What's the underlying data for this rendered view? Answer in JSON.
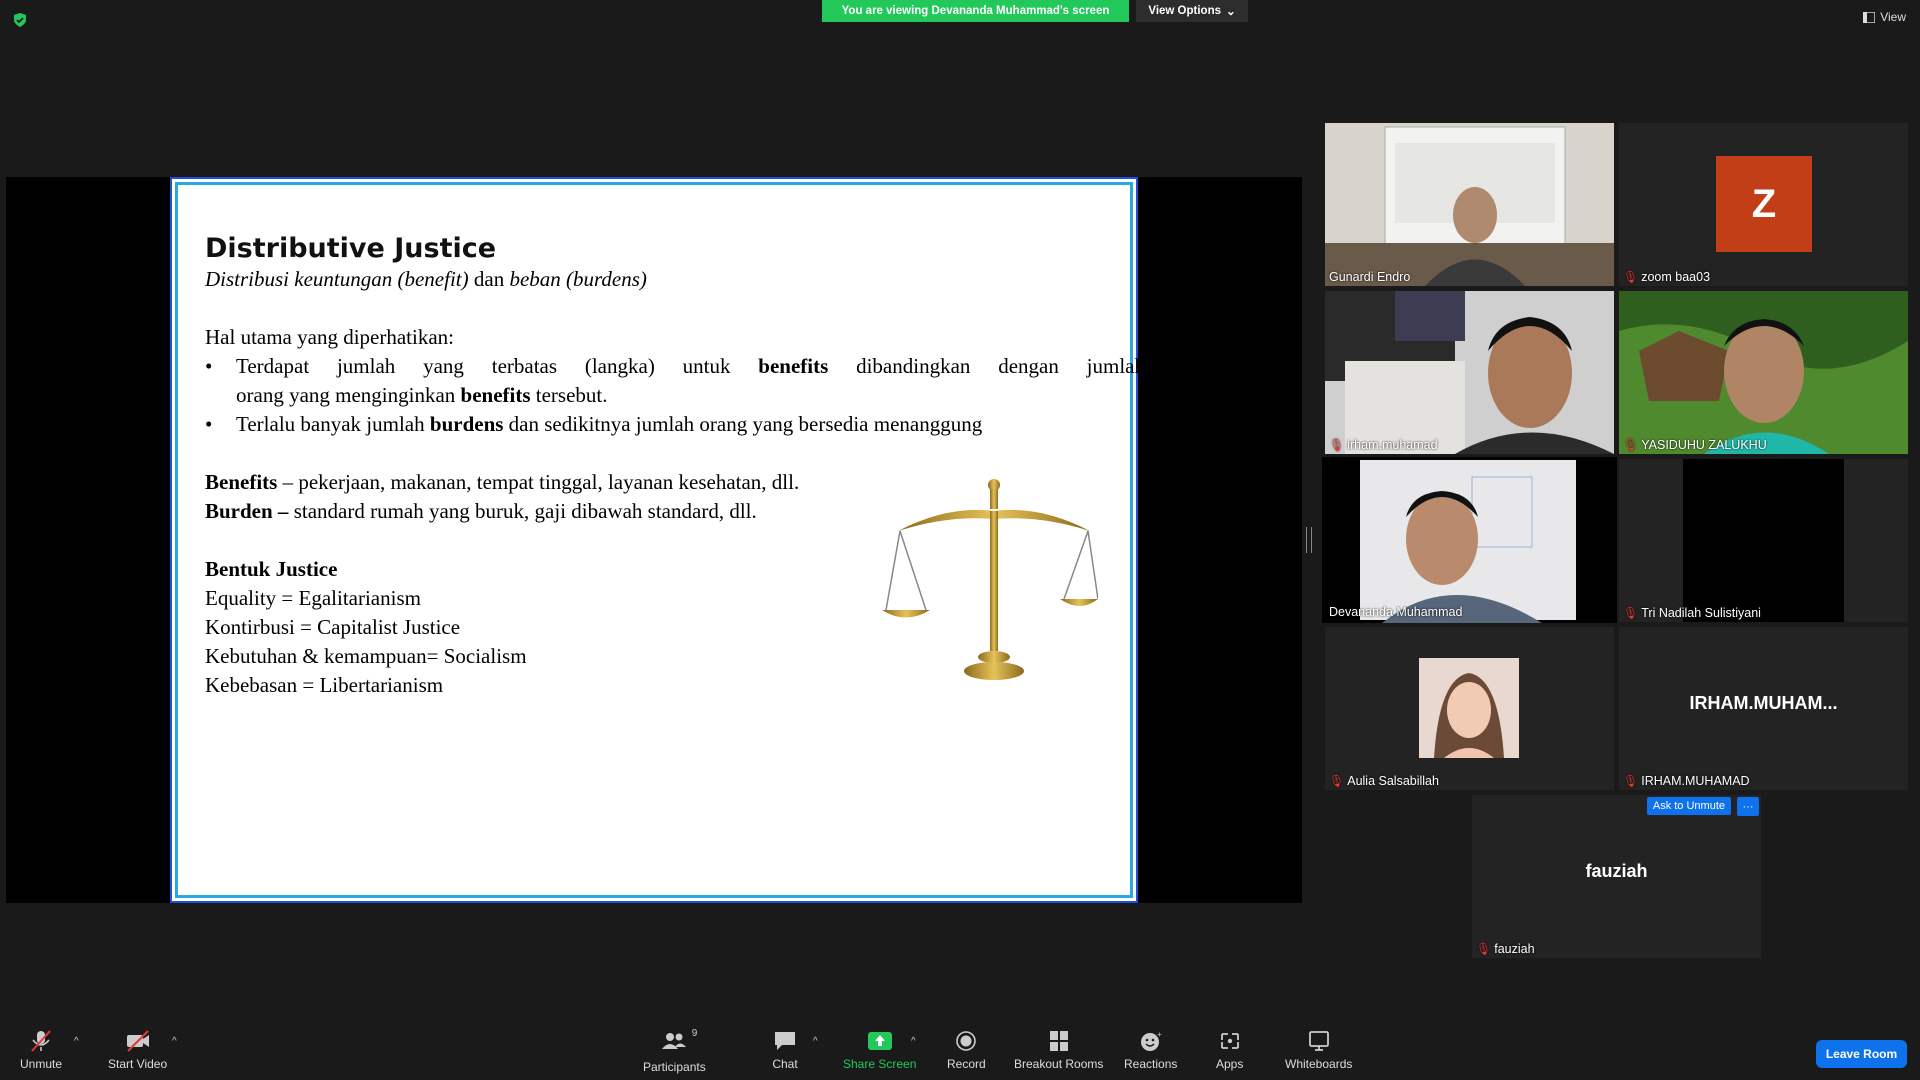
{
  "banner": {
    "viewing_text": "You are viewing Devananda Muhammad's screen",
    "view_options_label": "View Options",
    "view_label": "View"
  },
  "slide": {
    "title": "Distributive Justice",
    "subtitle_part1": "Distribusi keuntungan (benefit)",
    "subtitle_part2": " dan ",
    "subtitle_part3": "beban (burdens)",
    "intro": "Hal utama yang diperhatikan:",
    "bullet1_a": "Terdapat jumlah yang terbatas (langka) untuk ",
    "bullet1_b": "benefits",
    "bullet1_c": " dibandingkan dengan jumlah",
    "bullet1_line2_a": "orang yang menginginkan ",
    "bullet1_line2_b": "benefits",
    "bullet1_line2_c": " tersebut.",
    "bullet2_a": "Terlalu banyak jumlah ",
    "bullet2_b": "burdens",
    "bullet2_c": " dan sedikitnya jumlah orang yang bersedia menanggung",
    "benefits_label": "Benefits",
    "benefits_text": " – pekerjaan, makanan, tempat tinggal, layanan kesehatan, dll.",
    "burden_label": "Burden –",
    "burden_text": " standard rumah yang buruk, gaji dibawah standard, dll.",
    "forms_title": "Bentuk Justice",
    "forms": [
      "Equality = Egalitarianism",
      "Kontirbusi = Capitalist Justice",
      "Kebutuhan & kemampuan= Socialism",
      "Kebebasan = Libertarianism"
    ]
  },
  "participants": [
    {
      "name": "Gunardi Endro",
      "muted": false
    },
    {
      "name": "zoom baa03",
      "muted": true,
      "avatar_letter": "Z"
    },
    {
      "name": "irham.muhamad",
      "muted": true
    },
    {
      "name": "YASIDUHU ZALUKHU",
      "muted": true
    },
    {
      "name": "Devananda Muhammad",
      "muted": false,
      "active_speaker": true
    },
    {
      "name": "Tri Nadilah Sulistiyani",
      "muted": true
    },
    {
      "name": "Aulia Salsabillah",
      "muted": true
    },
    {
      "name": "IRHAM.MUHAMAD",
      "muted": true,
      "display_text": "IRHAM.MUHAM..."
    },
    {
      "name": "fauziah",
      "muted": true,
      "display_text": "fauziah",
      "ask_to_unmute_label": "Ask to Unmute",
      "more_label": "···"
    }
  ],
  "toolbar": {
    "unmute": "Unmute",
    "start_video": "Start Video",
    "participants": "Participants",
    "participant_count": "9",
    "chat": "Chat",
    "share_screen": "Share Screen",
    "record": "Record",
    "breakout_rooms": "Breakout Rooms",
    "reactions": "Reactions",
    "apps": "Apps",
    "whiteboards": "Whiteboards",
    "leave_room": "Leave Room"
  },
  "colors": {
    "share_green": "#23c85a",
    "zoom_blue": "#0e72ed",
    "active_speaker": "#e7e36a",
    "muted_red": "#e53935",
    "avatar_orange": "#c13e17"
  },
  "icons": [
    "shield-icon",
    "view-grid-icon",
    "mic-muted-icon",
    "video-off-icon",
    "participants-icon",
    "chat-icon",
    "share-screen-icon",
    "record-icon",
    "breakout-rooms-icon",
    "reactions-icon",
    "apps-icon",
    "whiteboard-icon"
  ]
}
